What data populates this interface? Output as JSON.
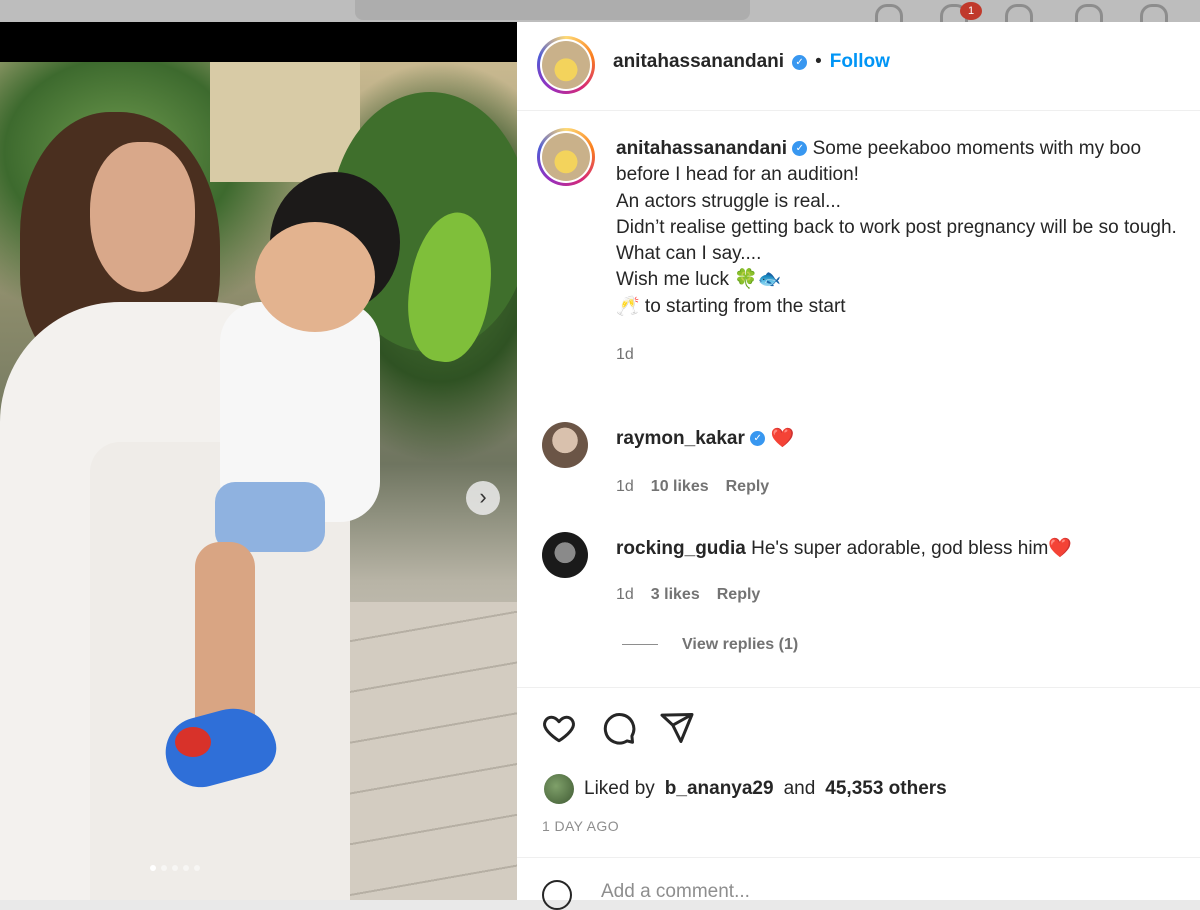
{
  "topbar": {
    "notification_count": "1"
  },
  "post": {
    "media": {
      "carousel_count": 5,
      "active_index": 0
    },
    "header": {
      "username": "anitahassanandani",
      "separator": "•",
      "follow_label": "Follow"
    },
    "caption": {
      "username": "anitahassanandani",
      "lines": [
        "Some peekaboo moments with my boo before I head for an audition!",
        "An actors struggle is real...",
        "Didn’t realise getting back to work post pregnancy will be so tough.",
        "What can I say....",
        "Wish me luck 🍀🐟",
        "🥂 to starting from the start"
      ],
      "time": "1d"
    },
    "comments": [
      {
        "username": "raymon_kakar",
        "text": "❤️",
        "time": "1d",
        "likes": "10 likes",
        "reply_label": "Reply"
      },
      {
        "username": "rocking_gudia",
        "text": "He's super adorable, god bless him❤️",
        "time": "1d",
        "likes": "3 likes",
        "reply_label": "Reply",
        "view_replies": "View replies (1)"
      }
    ],
    "liked_by": {
      "prefix": "Liked by",
      "user": "b_ananya29",
      "and": "and",
      "others": "45,353 others"
    },
    "timestamp": "1 DAY AGO",
    "add_comment_placeholder": "Add a comment..."
  },
  "icons": [
    "heart-icon",
    "comment-icon",
    "share-icon",
    "emoji-icon",
    "chevron-right-icon",
    "verified-badge-icon"
  ],
  "colors": {
    "link_blue": "#0095f6",
    "verified_blue": "#3897f0",
    "heart_red": "#e0252f",
    "muted_gray": "#737373"
  }
}
